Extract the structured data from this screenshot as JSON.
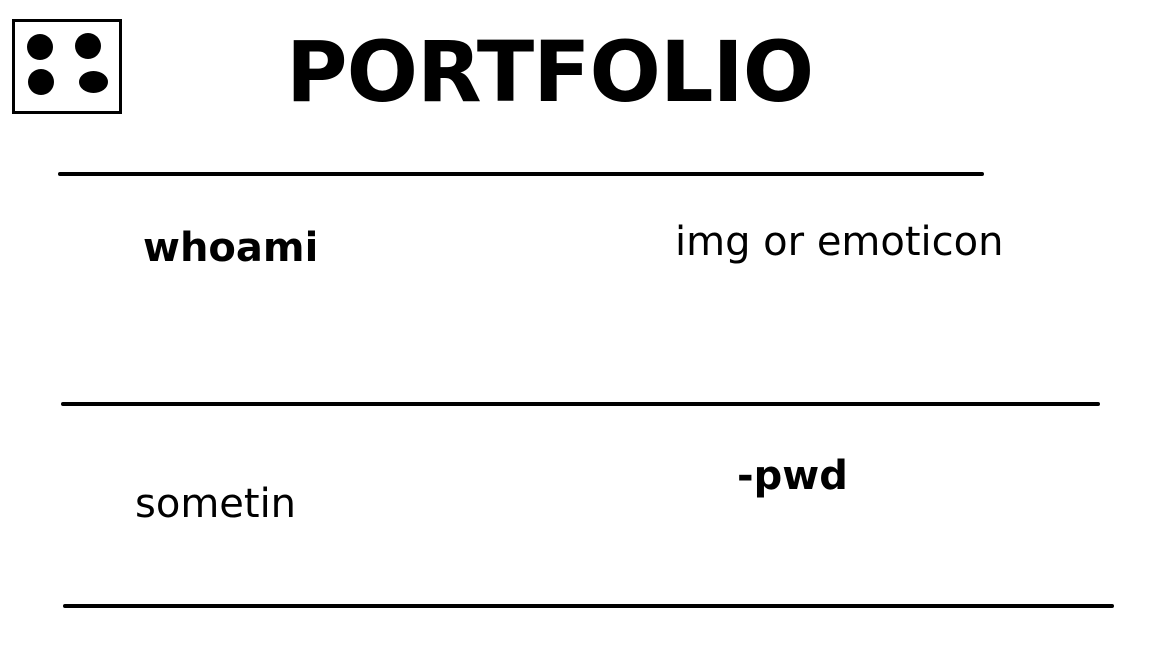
{
  "header": {
    "menu_icon": "four-dots-menu-icon",
    "title": "PORTFOLIO"
  },
  "section_about": {
    "left_label": "whoami",
    "right_label": "img or emoticon"
  },
  "section_second": {
    "left_label": "sometin",
    "right_label": "-pwd"
  }
}
